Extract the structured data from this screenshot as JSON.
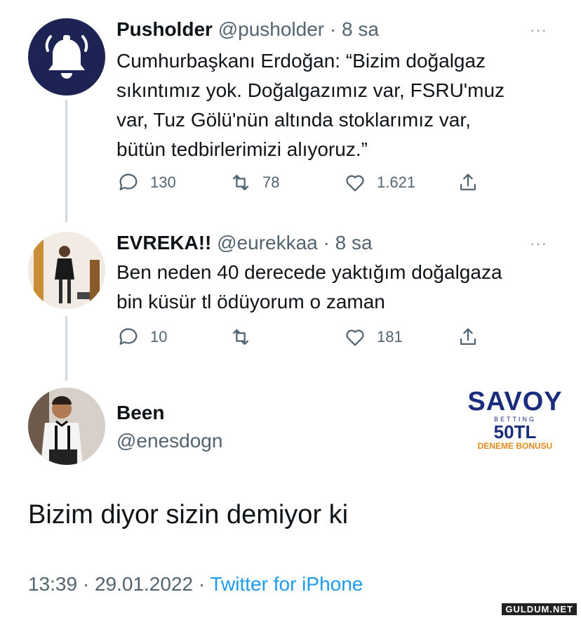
{
  "tweets": [
    {
      "name": "Pusholder",
      "handle": "@pusholder",
      "time": "· 8 sa",
      "text_lines": [
        "Cumhurbaşkanı Erdoğan: “Bizim doğalgaz",
        "sıkıntımız yok. Doğalgazımız var, FSRU'muz",
        "var, Tuz Gölü'nün altında stoklarımız var,",
        "bütün tedbirlerimizi alıyoruz.”"
      ],
      "replies": "130",
      "retweets": "78",
      "likes": "1.621",
      "more": "···"
    },
    {
      "name": "EVREKA!!",
      "handle": "@eurekkaa",
      "time": "· 8 sa",
      "text_lines": [
        "Ben neden 40 derecede yaktığım doğalgaza",
        "bin küsür tl ödüyorum o zaman"
      ],
      "replies": "10",
      "retweets": "",
      "likes": "181",
      "more": "···"
    }
  ],
  "main_tweet": {
    "name": "Been",
    "handle": "@enesdogn",
    "text": "Bizim diyor sizin demiyor ki",
    "timestamp": "13:39 · 29.01.2022 ·",
    "source": "Twitter for iPhone"
  },
  "ad": {
    "brand": "SAVOY",
    "sub": "BETTING",
    "amount": "50TL",
    "bonus": "DENEME BONUSU"
  },
  "watermark": "GULDUM.NET",
  "colors": {
    "text": "#0f1419",
    "secondary": "#536471",
    "link": "#1d9bf0",
    "pusholder_avatar": "#1d2353"
  }
}
